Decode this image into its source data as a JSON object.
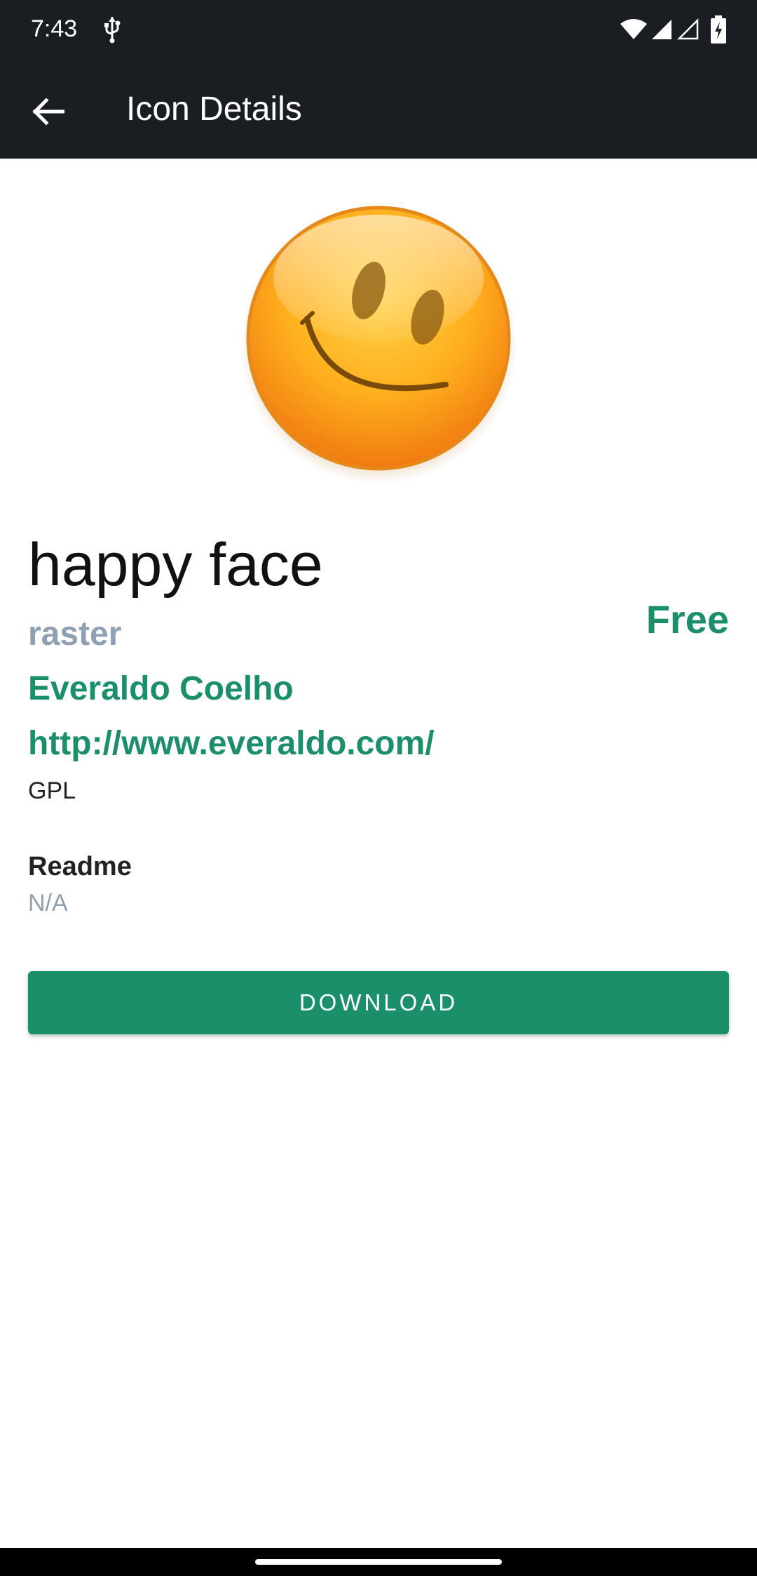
{
  "status_bar": {
    "time": "7:43",
    "icons": [
      "usb-icon",
      "wifi-icon",
      "cell-signal-icon",
      "cell-signal-empty-icon",
      "battery-charging-icon"
    ]
  },
  "app_bar": {
    "back_icon": "arrow-back-icon",
    "title": "Icon Details"
  },
  "icon_preview": {
    "icon": "happy-face-icon"
  },
  "details": {
    "name": "happy face",
    "type": "raster",
    "price": "Free",
    "author": "Everaldo Coelho",
    "url": "http://www.everaldo.com/",
    "license": "GPL",
    "readme_label": "Readme",
    "readme_value": "N/A"
  },
  "actions": {
    "download_label": "DOWNLOAD"
  },
  "colors": {
    "accent": "#1b8f6a",
    "secondary_text": "#8fa0b3",
    "app_bar": "#1a1d21"
  }
}
